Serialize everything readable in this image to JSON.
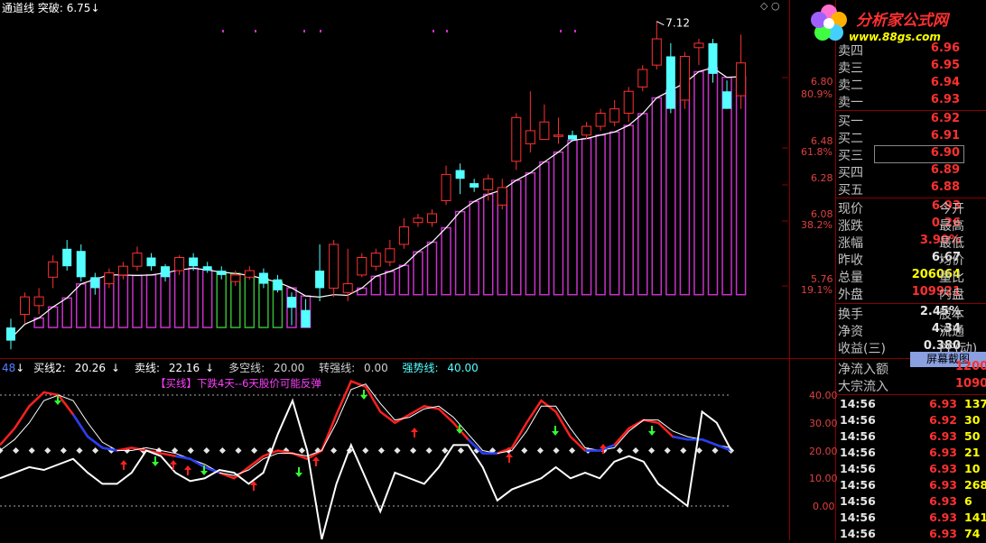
{
  "header": {
    "indicator_name": "通道线",
    "break_label": "突破:",
    "break_value": "6.75",
    "arrow": "↓"
  },
  "corner_icons": [
    "diamond-icon",
    "circle-icon"
  ],
  "main_chart": {
    "price_axis": [
      {
        "label": "6.80"
      },
      {
        "label": "80.9%"
      },
      {
        "label": "6.48"
      },
      {
        "label": "61.8%"
      },
      {
        "label": "6.28"
      },
      {
        "label": "6.08"
      },
      {
        "label": "38.2%"
      },
      {
        "label": "5.76"
      },
      {
        "label": "19.1%"
      }
    ],
    "high_marker": "7.12"
  },
  "chart_data": {
    "type": "candlestick",
    "title": "",
    "candles": [
      {
        "o": 5.72,
        "c": 5.66,
        "h": 5.76,
        "l": 5.62
      },
      {
        "o": 5.78,
        "c": 5.86,
        "h": 5.88,
        "l": 5.74
      },
      {
        "o": 5.82,
        "c": 5.86,
        "h": 5.9,
        "l": 5.78
      },
      {
        "o": 5.95,
        "c": 6.02,
        "h": 6.05,
        "l": 5.9
      },
      {
        "o": 6.08,
        "c": 6.0,
        "h": 6.12,
        "l": 5.98
      },
      {
        "o": 6.07,
        "c": 5.95,
        "h": 6.1,
        "l": 5.93
      },
      {
        "o": 5.95,
        "c": 5.9,
        "h": 5.97,
        "l": 5.87
      },
      {
        "o": 5.92,
        "c": 5.97,
        "h": 5.99,
        "l": 5.9
      },
      {
        "o": 5.96,
        "c": 6.0,
        "h": 6.02,
        "l": 5.94
      },
      {
        "o": 6.0,
        "c": 6.06,
        "h": 6.09,
        "l": 5.98
      },
      {
        "o": 6.04,
        "c": 6.0,
        "h": 6.06,
        "l": 5.98
      },
      {
        "o": 6.0,
        "c": 5.95,
        "h": 6.01,
        "l": 5.93
      },
      {
        "o": 5.98,
        "c": 6.04,
        "h": 6.05,
        "l": 5.96
      },
      {
        "o": 6.04,
        "c": 6.0,
        "h": 6.06,
        "l": 5.98
      },
      {
        "o": 6.0,
        "c": 5.98,
        "h": 6.02,
        "l": 5.97
      },
      {
        "o": 5.98,
        "c": 5.96,
        "h": 6.0,
        "l": 5.94
      },
      {
        "o": 5.93,
        "c": 5.96,
        "h": 5.98,
        "l": 5.91
      },
      {
        "o": 5.95,
        "c": 5.98,
        "h": 6.0,
        "l": 5.94
      },
      {
        "o": 5.97,
        "c": 5.92,
        "h": 5.99,
        "l": 5.9
      },
      {
        "o": 5.94,
        "c": 5.89,
        "h": 5.96,
        "l": 5.88
      },
      {
        "o": 5.86,
        "c": 5.81,
        "h": 5.88,
        "l": 5.73
      },
      {
        "o": 5.8,
        "c": 5.72,
        "h": 5.85,
        "l": 5.72
      },
      {
        "o": 5.98,
        "c": 5.9,
        "h": 6.1,
        "l": 5.84
      },
      {
        "o": 5.9,
        "c": 6.1,
        "h": 6.12,
        "l": 5.86
      },
      {
        "o": 5.88,
        "c": 5.92,
        "h": 6.08,
        "l": 5.84
      },
      {
        "o": 5.96,
        "c": 6.04,
        "h": 6.06,
        "l": 5.95
      },
      {
        "o": 6.0,
        "c": 6.06,
        "h": 6.08,
        "l": 5.98
      },
      {
        "o": 6.02,
        "c": 6.08,
        "h": 6.12,
        "l": 6.0
      },
      {
        "o": 6.1,
        "c": 6.18,
        "h": 6.22,
        "l": 6.08
      },
      {
        "o": 6.2,
        "c": 6.22,
        "h": 6.24,
        "l": 6.18
      },
      {
        "o": 6.2,
        "c": 6.24,
        "h": 6.26,
        "l": 6.18
      },
      {
        "o": 6.3,
        "c": 6.42,
        "h": 6.46,
        "l": 6.28
      },
      {
        "o": 6.44,
        "c": 6.4,
        "h": 6.47,
        "l": 6.33
      },
      {
        "o": 6.38,
        "c": 6.36,
        "h": 6.4,
        "l": 6.34
      },
      {
        "o": 6.35,
        "c": 6.4,
        "h": 6.42,
        "l": 6.3
      },
      {
        "o": 6.28,
        "c": 6.36,
        "h": 6.4,
        "l": 6.26
      },
      {
        "o": 6.48,
        "c": 6.68,
        "h": 6.7,
        "l": 6.44
      },
      {
        "o": 6.56,
        "c": 6.62,
        "h": 6.8,
        "l": 6.52
      },
      {
        "o": 6.58,
        "c": 6.66,
        "h": 6.74,
        "l": 6.58
      },
      {
        "o": 6.6,
        "c": 6.6,
        "h": 6.68,
        "l": 6.56
      },
      {
        "o": 6.6,
        "c": 6.58,
        "h": 6.62,
        "l": 6.57
      },
      {
        "o": 6.6,
        "c": 6.64,
        "h": 6.66,
        "l": 6.58
      },
      {
        "o": 6.64,
        "c": 6.7,
        "h": 6.72,
        "l": 6.62
      },
      {
        "o": 6.66,
        "c": 6.72,
        "h": 6.76,
        "l": 6.64
      },
      {
        "o": 6.7,
        "c": 6.8,
        "h": 6.82,
        "l": 6.66
      },
      {
        "o": 6.82,
        "c": 6.9,
        "h": 6.92,
        "l": 6.8
      },
      {
        "o": 6.92,
        "c": 7.04,
        "h": 7.12,
        "l": 6.9
      },
      {
        "o": 6.96,
        "c": 6.72,
        "h": 7.02,
        "l": 6.7
      },
      {
        "o": 6.76,
        "c": 6.96,
        "h": 6.98,
        "l": 6.72
      },
      {
        "o": 7.0,
        "c": 7.02,
        "h": 7.04,
        "l": 6.92
      },
      {
        "o": 7.02,
        "c": 6.88,
        "h": 7.04,
        "l": 6.84
      },
      {
        "o": 6.8,
        "c": 6.72,
        "h": 6.85,
        "l": 6.72
      },
      {
        "o": 6.78,
        "c": 6.93,
        "h": 7.06,
        "l": 6.72
      }
    ],
    "indicator": {
      "name": "买线2",
      "series": [
        {
          "name": "买线2",
          "value": "20.26"
        },
        {
          "name": "卖线",
          "value": "22.16"
        },
        {
          "name": "多空线",
          "value": "20.00"
        },
        {
          "name": "转强线",
          "value": "0.00"
        },
        {
          "name": "强势线",
          "value": "40.00"
        }
      ],
      "axis": [
        "40.00",
        "30.00",
        "20.00",
        "10.00",
        "0.00"
      ],
      "ylim": [
        -10,
        50
      ]
    }
  },
  "indicator_header": {
    "prefix_fragment": "48",
    "arrow": "↓",
    "buy2_label": "买线2:",
    "buy2_value": "20.26",
    "sell_label": "卖线:",
    "sell_value": "22.16",
    "longshort_label": "多空线:",
    "longshort_value": "20.00",
    "strong_label": "转强线:",
    "strong_value": "0.00",
    "power_label": "强势线:",
    "power_value": "40.00",
    "note": "【买线】下跌4天--6天股价可能反弹"
  },
  "logo": {
    "name": "分析家公式网",
    "url": "www.88gs.com"
  },
  "order_book": {
    "asks": [
      {
        "label": "卖四",
        "price": "6.96"
      },
      {
        "label": "卖三",
        "price": "6.95"
      },
      {
        "label": "卖二",
        "price": "6.94"
      },
      {
        "label": "卖一",
        "price": "6.93"
      }
    ],
    "bids": [
      {
        "label": "买一",
        "price": "6.92"
      },
      {
        "label": "买二",
        "price": "6.91"
      },
      {
        "label": "买三",
        "price": "6.90"
      },
      {
        "label": "买四",
        "price": "6.89"
      },
      {
        "label": "买五",
        "price": "6.88"
      }
    ]
  },
  "quote": [
    {
      "l1": "现价",
      "v": "6.93",
      "c": "red",
      "l2": "今开"
    },
    {
      "l1": "涨跌",
      "v": "0.26",
      "c": "red",
      "l2": "最高"
    },
    {
      "l1": "涨幅",
      "v": "3.90%",
      "c": "red",
      "l2": "最低"
    },
    {
      "l1": "昨收",
      "v": "6.67",
      "c": "white",
      "l2": "均价"
    },
    {
      "l1": "总量",
      "v": "206064",
      "c": "yellow",
      "l2": "量比"
    },
    {
      "l1": "外盘",
      "v": "109921",
      "c": "red",
      "l2": "内盘"
    }
  ],
  "quote2": [
    {
      "l1": "换手",
      "v": "2.45%",
      "c": "white",
      "l2": "股本"
    },
    {
      "l1": "净资",
      "v": "4.34",
      "c": "white",
      "l2": "流通"
    },
    {
      "l1": "收益(三)",
      "v": "0.380",
      "c": "white",
      "l2": "PE(动)"
    }
  ],
  "flow": [
    {
      "label": "净流入额",
      "value": "1200"
    },
    {
      "label": "大宗流入",
      "value": "1090"
    }
  ],
  "screenshot_button": "屏幕截图",
  "ticks": [
    {
      "time": "14:56",
      "price": "6.93",
      "vol": "137"
    },
    {
      "time": "14:56",
      "price": "6.92",
      "vol": "30"
    },
    {
      "time": "14:56",
      "price": "6.93",
      "vol": "50"
    },
    {
      "time": "14:56",
      "price": "6.93",
      "vol": "21"
    },
    {
      "time": "14:56",
      "price": "6.93",
      "vol": "10"
    },
    {
      "time": "14:56",
      "price": "6.93",
      "vol": "268"
    },
    {
      "time": "14:56",
      "price": "6.93",
      "vol": "6"
    },
    {
      "time": "14:56",
      "price": "6.93",
      "vol": "141"
    },
    {
      "time": "14:56",
      "price": "6.93",
      "vol": "74"
    }
  ],
  "colors": {
    "up": "#ff3030",
    "down": "#54ffff",
    "channel": "#c832c8",
    "bg": "#000000"
  }
}
